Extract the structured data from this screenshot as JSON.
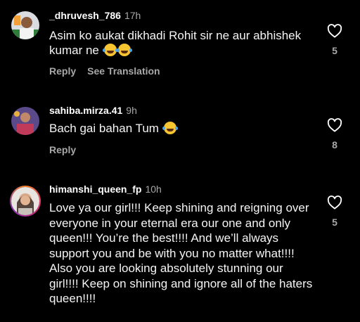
{
  "comments": [
    {
      "username": "_dhruvesh_786",
      "time": "17h",
      "text": "Asim ko aukat dikhadi Rohit sir ne aur abhishek kumar ne",
      "emoji": [
        "laughing-tears-emoji",
        "laughing-tears-emoji"
      ],
      "reply_label": "Reply",
      "translate_label": "See Translation",
      "likes": "5"
    },
    {
      "username": "sahiba.mirza.41",
      "time": "9h",
      "text": "Bach gai bahan Tum",
      "emoji": [
        "laughing-tears-emoji"
      ],
      "reply_label": "Reply",
      "likes": "8"
    },
    {
      "username": "himanshi_queen_fp",
      "time": "10h",
      "text": "Love ya our girl!!! Keep shining and reigning over everyone in your eternal era our one and only queen!!! You’re the best!!!! And we’ll always support you and be with you no matter what!!!! Also you are looking absolutely stunning our girl!!!! Keep on shining and ignore all of the haters queen!!!!",
      "likes": "5"
    }
  ],
  "colors": {
    "background": "#000000",
    "text": "#ffffff",
    "secondary": "#a8a8a8",
    "story_ring": "#dd2a7b"
  },
  "icons": {
    "like": "heart-outline-icon"
  }
}
